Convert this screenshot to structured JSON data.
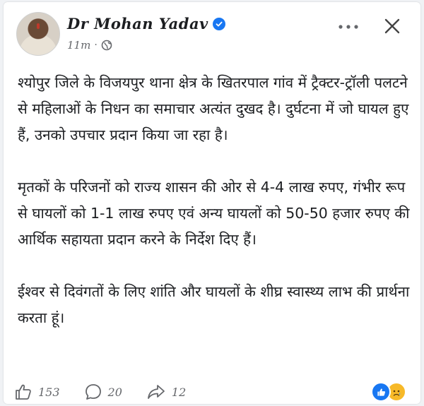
{
  "post": {
    "author": "Dr Mohan Yadav",
    "time": "11m",
    "separator": "·",
    "paragraphs": [
      "श्योपुर जिले के विजयपुर थाना क्षेत्र के खितरपाल गांव में ट्रैक्टर-ट्रॉली पलटने से महिलाओं के निधन का समाचार अत्यंत दुखद है। दुर्घटना में जो घायल हुए हैं, उनको उपचार प्रदान किया जा रहा है।",
      "मृतकों के परिजनों को राज्य शासन की ओर से 4-4 लाख रुपए, गंभीर रूप से घायलों को 1-1 लाख रुपए एवं अन्य घायलों को 50-50 हजार रुपए की आर्थिक सहायता प्रदान करने के निर्देश दिए हैं।",
      "ईश्वर से दिवंगतों के लिए शांति और घायलों के शीघ्र स्वास्थ्य लाभ की प्रार्थना करता हूं।"
    ],
    "likes": "153",
    "comments": "20",
    "shares": "12"
  },
  "colors": {
    "accent": "#1877f2",
    "sad_reaction": "#f7b928",
    "text": "#1c1e21",
    "muted": "#65676b"
  },
  "icons": {
    "verified": "verified-badge-icon",
    "audience": "globe-icon",
    "more": "more-options-icon",
    "close": "close-icon",
    "like": "thumbs-up-icon",
    "comment": "comment-icon",
    "share": "share-icon",
    "reactions": [
      "like-reaction-icon",
      "sad-reaction-icon"
    ]
  }
}
